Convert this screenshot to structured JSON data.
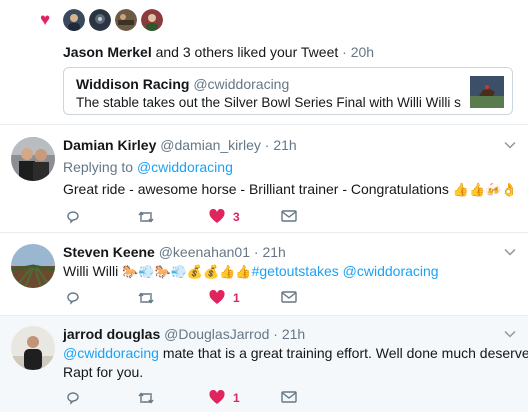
{
  "notification": {
    "liker_name": "Jason Merkel",
    "liked_text": "and 3 others liked your Tweet",
    "separator": "·",
    "time": "20h",
    "quoted": {
      "name": "Widdison Racing",
      "handle": "@cwiddoracing",
      "text": "The stable takes out the Silver Bowl Series Final with Willi Willi sco..."
    }
  },
  "tweets": [
    {
      "name": "Damian Kirley",
      "handle": "@damian_kirley",
      "time": "21h",
      "replying_label": "Replying to",
      "replying_handle": "@cwiddoracing",
      "text": "Great ride - awesome horse - Brilliant trainer - Congratulations",
      "emojis": "👍👍🍻👌",
      "like_count": "3"
    },
    {
      "name": "Steven Keene",
      "handle": "@keenahan01",
      "time": "21h",
      "text": "Willi Willi",
      "emojis": "🐎💨🐎💨💰💰👍👍",
      "hashtag": "#getoutstakes",
      "mention": "@cwiddoracing",
      "like_count": "1"
    },
    {
      "name": "jarrod douglas",
      "handle": "@DouglasJarrod",
      "time": "21h",
      "mention": "@cwiddoracing",
      "text_line1": "mate that is a great training effort. Well done much deserved.",
      "text_line2": "Rapt for you.",
      "like_count": "1"
    }
  ],
  "colors": {
    "like": "#e0245e",
    "link": "#1da1f2",
    "muted": "#657786",
    "border": "#e6ecf0"
  }
}
